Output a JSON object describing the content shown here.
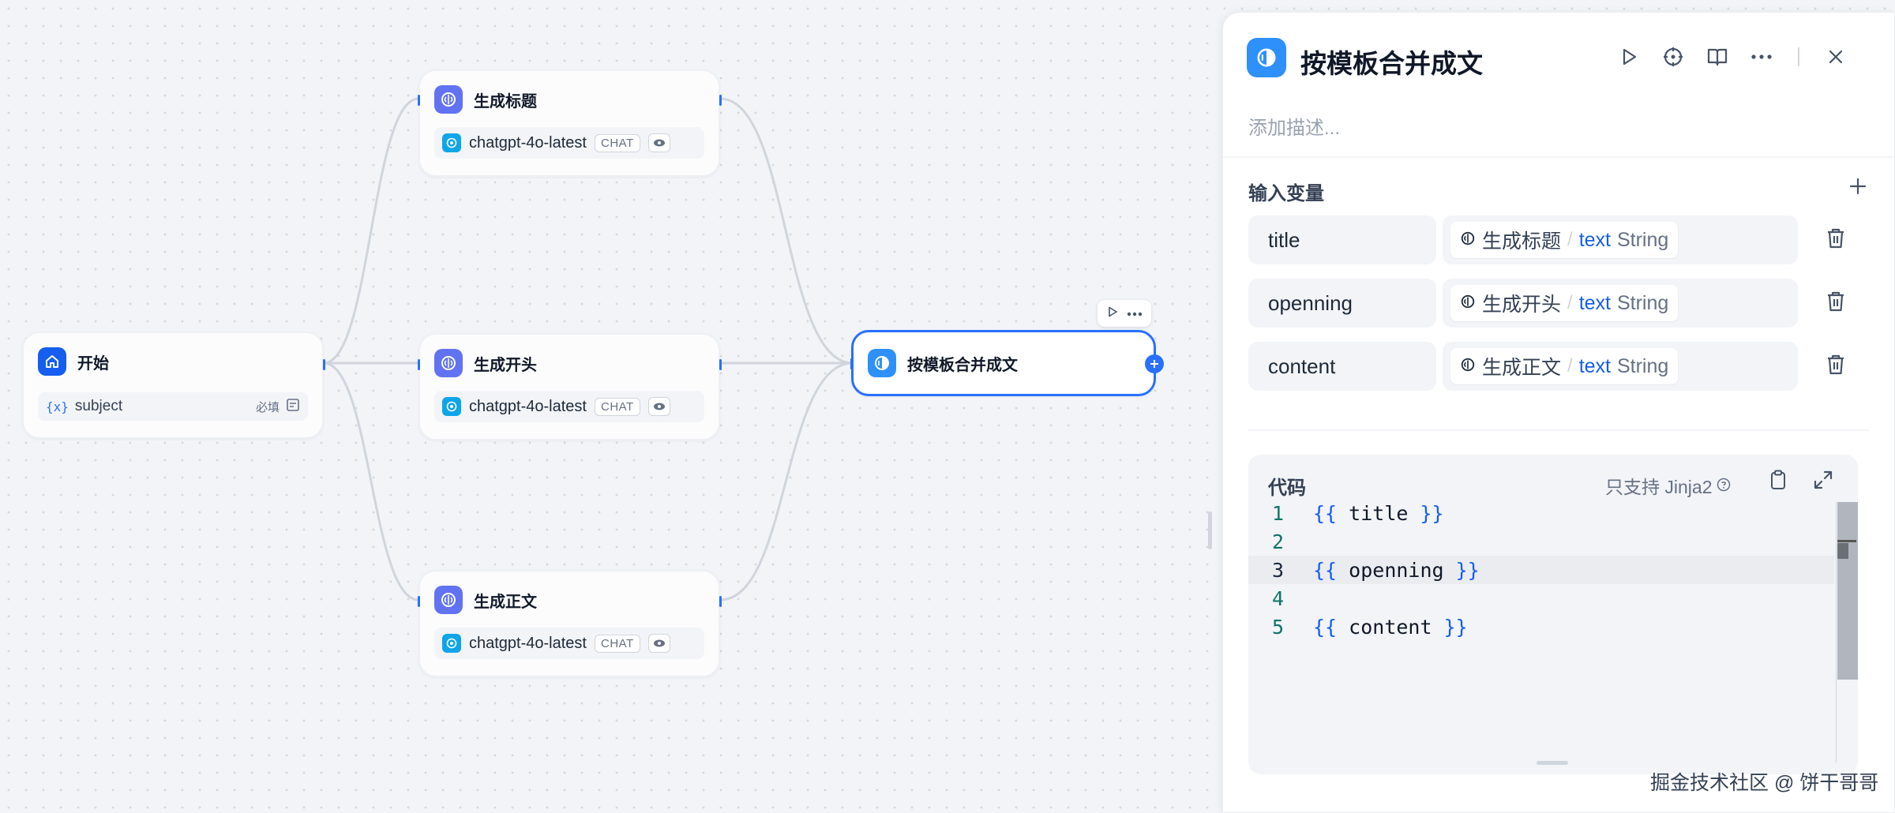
{
  "colors": {
    "accent": "#155eef",
    "llm_icon": "#6172f3",
    "template_icon": "#2e90fa",
    "edge": "#d0d5dd",
    "selected_border": "#2970ff"
  },
  "canvas": {
    "start_node": {
      "title": "开始",
      "icon": "home-icon",
      "variable": {
        "symbol": "{x}",
        "name": "subject",
        "required": "必填"
      }
    },
    "llm_nodes": [
      {
        "title": "生成标题",
        "model": "chatgpt-4o-latest",
        "mode": "CHAT",
        "icon": "brain-icon"
      },
      {
        "title": "生成开头",
        "model": "chatgpt-4o-latest",
        "mode": "CHAT",
        "icon": "brain-icon"
      },
      {
        "title": "生成正文",
        "model": "chatgpt-4o-latest",
        "mode": "CHAT",
        "icon": "brain-icon"
      }
    ],
    "template_node": {
      "title": "按模板合并成文",
      "icon": "template-icon",
      "selected": true
    }
  },
  "panel": {
    "title": "按模板合并成文",
    "description_placeholder": "添加描述...",
    "tools": [
      "play-icon",
      "locate-icon",
      "book-icon",
      "more-icon",
      "close-icon"
    ],
    "input_section_title": "输入变量",
    "input_variables": [
      {
        "name": "title",
        "source_node": "生成标题",
        "source_var": "text",
        "type": "String"
      },
      {
        "name": "openning",
        "source_node": "生成开头",
        "source_var": "text",
        "type": "String"
      },
      {
        "name": "content",
        "source_node": "生成正文",
        "source_var": "text",
        "type": "String"
      }
    ],
    "code": {
      "label": "代码",
      "language_note": "只支持 Jinja2",
      "active_line": 3,
      "lines": [
        {
          "no": "1",
          "text": "{{ title }}"
        },
        {
          "no": "2",
          "text": ""
        },
        {
          "no": "3",
          "text": "{{ openning }}"
        },
        {
          "no": "4",
          "text": ""
        },
        {
          "no": "5",
          "text": "{{ content }}"
        }
      ]
    }
  },
  "watermark": "掘金技术社区 @ 饼干哥哥"
}
